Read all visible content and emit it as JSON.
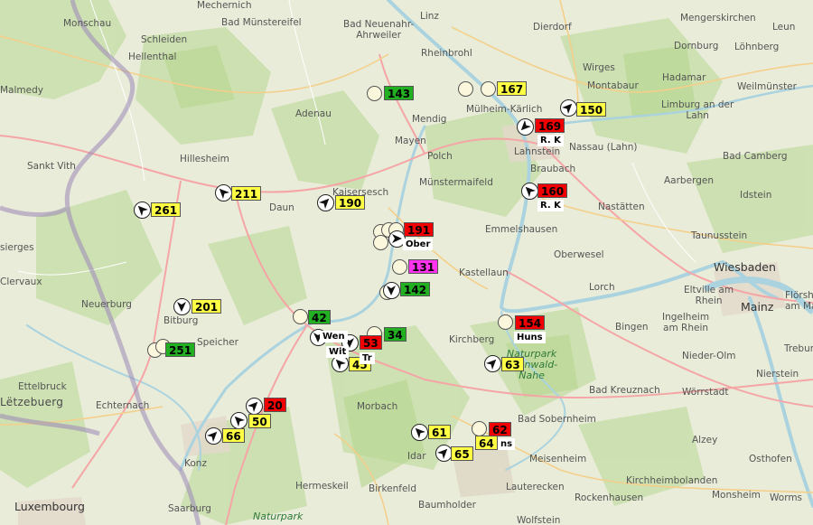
{
  "map": {
    "places": [
      {
        "id": "mechernich",
        "name": "Mechernich",
        "big": false
      },
      {
        "id": "monschau",
        "name": "Monschau",
        "big": false
      },
      {
        "id": "bad-muenstereifel",
        "name": "Bad Münstereifel",
        "big": false
      },
      {
        "id": "schleiden",
        "name": "Schleiden",
        "big": false
      },
      {
        "id": "hellenthal",
        "name": "Hellenthal",
        "big": false
      },
      {
        "id": "bad-neuenahr",
        "name": "Bad Neuenahr-\nAhrweiler",
        "big": false
      },
      {
        "id": "linz",
        "name": "Linz",
        "big": false
      },
      {
        "id": "dierdorf",
        "name": "Dierdorf",
        "big": false
      },
      {
        "id": "mengerskirchen",
        "name": "Mengerskirchen",
        "big": false
      },
      {
        "id": "leun",
        "name": "Leun",
        "big": false
      },
      {
        "id": "rheinbrohl",
        "name": "Rheinbrohl",
        "big": false
      },
      {
        "id": "dornburg",
        "name": "Dornburg",
        "big": false
      },
      {
        "id": "loehnberg",
        "name": "Löhnberg",
        "big": false
      },
      {
        "id": "wirges",
        "name": "Wirges",
        "big": false
      },
      {
        "id": "hadamar",
        "name": "Hadamar",
        "big": false
      },
      {
        "id": "malmedy",
        "name": "Malmedy",
        "big": false
      },
      {
        "id": "adenau",
        "name": "Adenau",
        "big": false
      },
      {
        "id": "mendig",
        "name": "Mendig",
        "big": false
      },
      {
        "id": "muelheim-kaerlich",
        "name": "Mülheim-Kärlich",
        "big": false
      },
      {
        "id": "montabaur",
        "name": "Montabaur",
        "big": false
      },
      {
        "id": "weilmuenster",
        "name": "Weilmünster",
        "big": false
      },
      {
        "id": "limburg",
        "name": "Limburg an der\nLahn",
        "big": false
      },
      {
        "id": "mayen",
        "name": "Mayen",
        "big": false
      },
      {
        "id": "lahnstein",
        "name": "Lahnstein",
        "big": false
      },
      {
        "id": "nassau",
        "name": "Nassau (Lahn)",
        "big": false
      },
      {
        "id": "hillesheim",
        "name": "Hillesheim",
        "big": false
      },
      {
        "id": "polch",
        "name": "Polch",
        "big": false
      },
      {
        "id": "sankt-vith",
        "name": "Sankt Vith",
        "big": false
      },
      {
        "id": "braubach",
        "name": "Braubach",
        "big": false
      },
      {
        "id": "bad-camberg",
        "name": "Bad Camberg",
        "big": false
      },
      {
        "id": "kaisersesch",
        "name": "Kaisersesch",
        "big": false
      },
      {
        "id": "muenstermaifeld",
        "name": "Münstermaifeld",
        "big": false
      },
      {
        "id": "aarbergen",
        "name": "Aarbergen",
        "big": false
      },
      {
        "id": "daun",
        "name": "Daun",
        "big": false
      },
      {
        "id": "nastaetten",
        "name": "Nastätten",
        "big": false
      },
      {
        "id": "idstein",
        "name": "Idstein",
        "big": false
      },
      {
        "id": "emmelshausen",
        "name": "Emmelshausen",
        "big": false
      },
      {
        "id": "taunusstein",
        "name": "Taunusstein",
        "big": false
      },
      {
        "id": "sierges",
        "name": "sierges",
        "big": false
      },
      {
        "id": "oberwesel",
        "name": "Oberwesel",
        "big": false
      },
      {
        "id": "kastellaun",
        "name": "Kastellaun",
        "big": false
      },
      {
        "id": "wiesbaden",
        "name": "Wiesbaden",
        "big": true
      },
      {
        "id": "clervaux",
        "name": "Clervaux",
        "big": false
      },
      {
        "id": "lorch",
        "name": "Lorch",
        "big": false
      },
      {
        "id": "neuerburg",
        "name": "Neuerburg",
        "big": false
      },
      {
        "id": "eltville",
        "name": "Eltville am\nRhein",
        "big": false
      },
      {
        "id": "mainz",
        "name": "Mainz",
        "big": true
      },
      {
        "id": "floersheim",
        "name": "Flörshei\nam Ma",
        "big": false
      },
      {
        "id": "bitburg",
        "name": "Bitburg",
        "big": false
      },
      {
        "id": "bingen",
        "name": "Bingen",
        "big": false
      },
      {
        "id": "ingelheim",
        "name": "Ingelheim\nam Rhein",
        "big": false
      },
      {
        "id": "speicher",
        "name": "Speicher",
        "big": false
      },
      {
        "id": "kirchberg",
        "name": "Kirchberg",
        "big": false
      },
      {
        "id": "trebur",
        "name": "Trebur",
        "big": false
      },
      {
        "id": "nieder-olm",
        "name": "Nieder-Olm",
        "big": false
      },
      {
        "id": "nierstein",
        "name": "Nierstein",
        "big": false
      },
      {
        "id": "ettelbruck",
        "name": "Ettelbruck",
        "big": false
      },
      {
        "id": "woerrstadt",
        "name": "Wörrstadt",
        "big": false
      },
      {
        "id": "bad-kreuznach",
        "name": "Bad Kreuznach",
        "big": false
      },
      {
        "id": "letzebuerg",
        "name": "Lëtzebuerg",
        "big": false,
        "country": true
      },
      {
        "id": "echternach",
        "name": "Echternach",
        "big": false
      },
      {
        "id": "morbach",
        "name": "Morbach",
        "big": false
      },
      {
        "id": "bad-sobernheim",
        "name": "Bad Sobernheim",
        "big": false
      },
      {
        "id": "alzey",
        "name": "Alzey",
        "big": false
      },
      {
        "id": "konz",
        "name": "Konz",
        "big": false
      },
      {
        "id": "idar",
        "name": "Idar",
        "big": false
      },
      {
        "id": "meisenheim",
        "name": "Meisenheim",
        "big": false
      },
      {
        "id": "osthofen",
        "name": "Osthofen",
        "big": false
      },
      {
        "id": "hermeskeil",
        "name": "Hermeskeil",
        "big": false
      },
      {
        "id": "birkenfeld",
        "name": "Birkenfeld",
        "big": false
      },
      {
        "id": "lauterecken",
        "name": "Lauterecken",
        "big": false
      },
      {
        "id": "kirchheimbolanden",
        "name": "Kirchheimbolanden",
        "big": false
      },
      {
        "id": "luxembourg",
        "name": "Luxembourg",
        "big": true
      },
      {
        "id": "baumholder",
        "name": "Baumholder",
        "big": false
      },
      {
        "id": "rockenhausen",
        "name": "Rockenhausen",
        "big": false
      },
      {
        "id": "saarburg",
        "name": "Saarburg",
        "big": false
      },
      {
        "id": "monsheim",
        "name": "Monsheim",
        "big": false
      },
      {
        "id": "worms",
        "name": "Worms",
        "big": false
      },
      {
        "id": "wolfstein",
        "name": "Wolfstein",
        "big": false
      },
      {
        "id": "naturpark-bottom",
        "name": "Naturpark",
        "big": false,
        "park": true
      },
      {
        "id": "naturpark-nahe",
        "name": "Naturpark\nSoonwald-\nNahe",
        "big": false,
        "park": true
      }
    ],
    "badges": [
      {
        "id": "b143",
        "value": "143",
        "color": "green"
      },
      {
        "id": "b167",
        "value": "167",
        "color": "yellow"
      },
      {
        "id": "b150",
        "value": "150",
        "color": "yellow"
      },
      {
        "id": "b169",
        "value": "169",
        "color": "red"
      },
      {
        "id": "b160",
        "value": "160",
        "color": "red"
      },
      {
        "id": "b211",
        "value": "211",
        "color": "yellow"
      },
      {
        "id": "b190",
        "value": "190",
        "color": "yellow"
      },
      {
        "id": "b261",
        "value": "261",
        "color": "yellow"
      },
      {
        "id": "b191",
        "value": "191",
        "color": "red"
      },
      {
        "id": "b131",
        "value": "131",
        "color": "magenta"
      },
      {
        "id": "b142",
        "value": "142",
        "color": "green"
      },
      {
        "id": "b201",
        "value": "201",
        "color": "yellow"
      },
      {
        "id": "b42",
        "value": "42",
        "color": "green"
      },
      {
        "id": "b34",
        "value": "34",
        "color": "green"
      },
      {
        "id": "b53",
        "value": "53",
        "color": "red"
      },
      {
        "id": "b154",
        "value": "154",
        "color": "red"
      },
      {
        "id": "b251",
        "value": "251",
        "color": "green"
      },
      {
        "id": "b45",
        "value": "45",
        "color": "yellow"
      },
      {
        "id": "b63",
        "value": "63",
        "color": "yellow"
      },
      {
        "id": "b20",
        "value": "20",
        "color": "red"
      },
      {
        "id": "b50",
        "value": "50",
        "color": "yellow"
      },
      {
        "id": "b66",
        "value": "66",
        "color": "yellow"
      },
      {
        "id": "b61",
        "value": "61",
        "color": "yellow"
      },
      {
        "id": "b62",
        "value": "62",
        "color": "red"
      },
      {
        "id": "b64",
        "value": "64",
        "color": "yellow"
      },
      {
        "id": "b65",
        "value": "65",
        "color": "yellow"
      }
    ],
    "tags": [
      {
        "id": "t-rk1",
        "text": "R. K"
      },
      {
        "id": "t-rk2",
        "text": "R. K"
      },
      {
        "id": "t-ober",
        "text": "Ober"
      },
      {
        "id": "t-wen",
        "text": "Wen"
      },
      {
        "id": "t-wit",
        "text": "Wit"
      },
      {
        "id": "t-tr",
        "text": "Tr"
      },
      {
        "id": "t-huns",
        "text": "Huns"
      },
      {
        "id": "t-ns",
        "text": "ns"
      }
    ],
    "colors": {
      "yellow": "#ffff44",
      "green": "#22b022",
      "red": "#f00000",
      "magenta": "#ff33ee",
      "marker_fill": "#fbf7dc",
      "forest": "#c6dfa8",
      "water": "#aad3df",
      "border": "#9b88b8"
    },
    "arrow_directions_deg": [
      225,
      45,
      315,
      315,
      45,
      315,
      90,
      180,
      180,
      180,
      180,
      315,
      45,
      45,
      315,
      45,
      315,
      45
    ]
  }
}
